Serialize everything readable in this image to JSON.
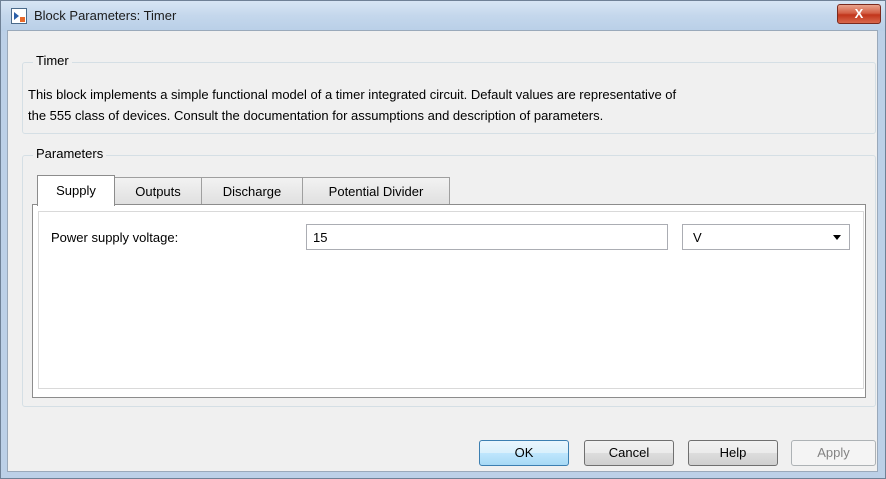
{
  "window": {
    "title": "Block Parameters: Timer",
    "close_label": "X"
  },
  "description_group": {
    "title": "Timer",
    "text_line1": "This block implements a simple functional model of a timer integrated circuit. Default values are representative of",
    "text_line2": "the 555 class of devices. Consult the documentation for assumptions and description of parameters."
  },
  "parameters_group": {
    "title": "Parameters"
  },
  "tabs": [
    {
      "label": "Supply",
      "active": true
    },
    {
      "label": "Outputs",
      "active": false
    },
    {
      "label": "Discharge",
      "active": false
    },
    {
      "label": "Potential Divider",
      "active": false
    }
  ],
  "supply": {
    "label": "Power supply voltage:",
    "value": "15",
    "unit": "V"
  },
  "buttons": {
    "ok": "OK",
    "cancel": "Cancel",
    "help": "Help",
    "apply": "Apply"
  },
  "colors": {
    "title_bar": "#c4d7ec",
    "client_bg": "#f0f0f0",
    "default_button": "#bee6fd",
    "close_button": "#c1351b"
  }
}
